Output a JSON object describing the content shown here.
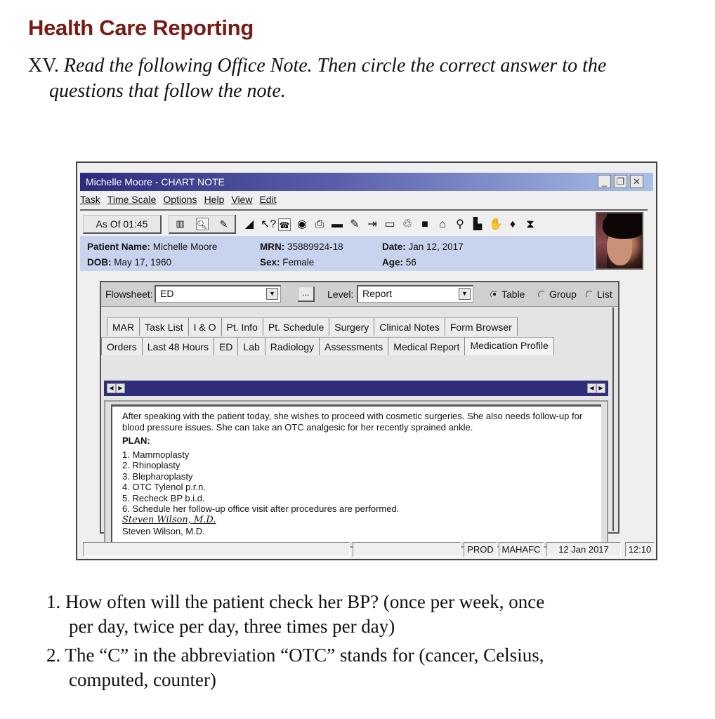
{
  "page": {
    "heading": "Health Care Reporting",
    "instruction_num": "XV.",
    "instruction_line1": "Read the following Office Note. Then circle the correct answer to the",
    "instruction_line2": "questions that follow the note."
  },
  "window": {
    "title": "Michelle Moore - CHART NOTE",
    "controls": {
      "minimize": "_",
      "restore": "❐",
      "close": "✕"
    },
    "menu": [
      "Task",
      "Time Scale",
      "Options",
      "Help",
      "View",
      "Edit"
    ],
    "toolbar": {
      "as_of_label": "As Of 01:45",
      "group_icons": [
        "bar-chart-icon",
        "magnify-document-icon",
        "notepad-icon"
      ],
      "icons": [
        {
          "name": "eraser-icon",
          "glyph": "◢"
        },
        {
          "name": "help-pointer-icon",
          "glyph": "↖?"
        },
        {
          "name": "phone-document-icon",
          "glyph": "☎"
        },
        {
          "name": "refresh-head-icon",
          "glyph": "◉"
        },
        {
          "name": "printer-icon",
          "glyph": "⎙"
        },
        {
          "name": "card-icon",
          "glyph": "▬"
        },
        {
          "name": "notepad-pencil-icon",
          "glyph": "✎"
        },
        {
          "name": "exit-door-icon",
          "glyph": "⇥"
        },
        {
          "name": "window-icon",
          "glyph": "▭"
        },
        {
          "name": "recycle-icon",
          "glyph": "♲"
        },
        {
          "name": "black-square-icon",
          "glyph": "■"
        },
        {
          "name": "home-icon",
          "glyph": "⌂"
        },
        {
          "name": "person-search-icon",
          "glyph": "⚲"
        },
        {
          "name": "book-icon",
          "glyph": "▙"
        },
        {
          "name": "hand-icon",
          "glyph": "✋"
        },
        {
          "name": "pour-icon",
          "glyph": "♦"
        },
        {
          "name": "hourglass-icon",
          "glyph": "⧗"
        }
      ]
    },
    "patient": {
      "name_label": "Patient Name:",
      "name": "Michelle Moore",
      "mrn_label": "MRN:",
      "mrn": "35889924-18",
      "date_label": "Date:",
      "date": "Jan 12, 2017",
      "dob_label": "DOB:",
      "dob": "May 17, 1960",
      "sex_label": "Sex:",
      "sex": "Female",
      "age_label": "Age:",
      "age": "56"
    },
    "flowsheet": {
      "label": "Flowsheet:",
      "value": "ED",
      "ellipsis": "...",
      "level_label": "Level:",
      "level_value": "Report",
      "view_options": [
        {
          "label": "Table",
          "selected": true
        },
        {
          "label": "Group",
          "selected": false
        },
        {
          "label": "List",
          "selected": false
        }
      ]
    },
    "tabs_row1": [
      "MAR",
      "Task List",
      "I & O",
      "Pt. Info",
      "Pt. Schedule",
      "Surgery",
      "Clinical Notes",
      "Form Browser"
    ],
    "tabs_row2": [
      "Orders",
      "Last 48 Hours",
      "ED",
      "Lab",
      "Radiology",
      "Assessments",
      "Medical Report",
      "Medication Profile"
    ],
    "active_tab": "Medication Profile",
    "note": {
      "paragraph": "After speaking with the patient today, she wishes to proceed with cosmetic surgeries. She also needs follow-up for blood pressure issues. She can take an OTC analgesic for her recently sprained ankle.",
      "plan_label": "PLAN:",
      "plan_items": [
        "1. Mammoplasty",
        "2. Rhinoplasty",
        "3. Blepharoplasty",
        "4. OTC Tylenol p.r.n.",
        "5. Recheck BP b.i.d.",
        "6. Schedule her follow-up office visit after procedures are performed."
      ],
      "signature": "Steven Wilson, M.D.",
      "signer": "Steven Wilson, M.D."
    },
    "statusbar": {
      "field1": "",
      "field2": "",
      "env": "PROD",
      "user": "MAHAFC",
      "date": "12 Jan 2017",
      "time": "12:10"
    }
  },
  "questions": [
    {
      "line1": "1. How often will the patient check her BP? (once per week, once",
      "line2": "per day, twice per day, three times per day)"
    },
    {
      "line1": "2. The “C” in the abbreviation “OTC” stands for (cancer, Celsius,",
      "line2": "computed, counter)"
    }
  ]
}
